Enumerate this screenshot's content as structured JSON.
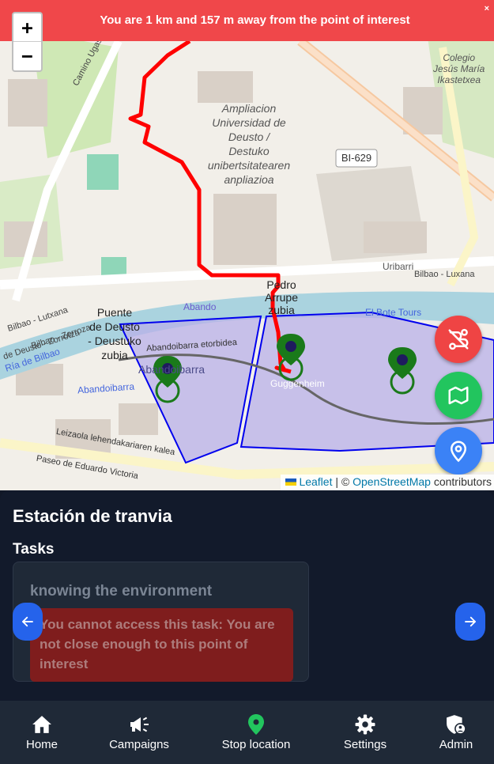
{
  "alert": {
    "message": "You are 1 km and 157 m away from the point of interest",
    "close_glyph": "×"
  },
  "map": {
    "zoom_in": "+",
    "zoom_out": "−",
    "labels": {
      "colegio": [
        "Colegio",
        "Jesús María",
        "Ikastetxea"
      ],
      "universidad": [
        "Ampliacion",
        "Universidad de",
        "Deusto /",
        "Destuko",
        "unibertsitatearen",
        "anpliazioa"
      ],
      "road_bi": "BI-629",
      "camino": "Camino Ugaskobidea",
      "uribarri": "Uribarri",
      "bilbao_luxana": "Bilbao - Luxana",
      "pedro_arrupe": [
        "Pedro",
        "Arrupe",
        "zubia"
      ],
      "puente_deusto": [
        "Puente",
        "de Deusto",
        "- Deustuko",
        "zubia"
      ],
      "abando": "Abando",
      "el_bote": "El Bote Tours",
      "abandoibarra_etorbidea": "Abandoibarra etorbidea",
      "abandoibarra": "Abandoibarra",
      "guggenheim": "Guggenheim",
      "bilbao_zorroza": "Bilbao - Zorroza",
      "luxana_left": "Bilbao - Lutxana",
      "ria": "Ría de Bilbao",
      "deusto_zorrotza": "de Deusto - Zorrotza",
      "abandoibarra_lower": "Abandoibarra",
      "leizaola": "Leizaola lehendakariaren kalea",
      "paseo_eduardo": "Paseo de Eduardo Victoria"
    },
    "attribution": {
      "leaflet": "Leaflet",
      "separator": " | © ",
      "osm": "OpenStreetMap",
      "suffix": " contributors"
    },
    "colors": {
      "route": "#ff0000",
      "marker": "#1a7a1a",
      "marker_dot": "#1e1b5e",
      "zone_stroke": "#0000ee",
      "zone_fill": "#b8b0e8"
    },
    "fab_icons": [
      "route-off-icon",
      "map-icon",
      "location-pin-icon"
    ]
  },
  "panel": {
    "stop_title": "Estación de tranvia",
    "tasks_label": "Tasks",
    "task": {
      "name": "knowing the environment",
      "warning_lines": [
        "You cannot access this task: You are",
        "not close enough to this point of",
        "interest"
      ]
    },
    "prev_icon": "arrow-left-icon",
    "next_icon": "arrow-right-icon"
  },
  "bottom_nav": {
    "items": [
      {
        "label": "Home",
        "icon": "home-icon",
        "color": "#ffffff"
      },
      {
        "label": "Campaigns",
        "icon": "megaphone-icon",
        "color": "#ffffff"
      },
      {
        "label": "Stop location",
        "icon": "map-pin-icon",
        "color": "#22c55e"
      },
      {
        "label": "Settings",
        "icon": "gear-icon",
        "color": "#ffffff"
      },
      {
        "label": "Admin",
        "icon": "admin-shield-icon",
        "color": "#ffffff"
      }
    ]
  }
}
